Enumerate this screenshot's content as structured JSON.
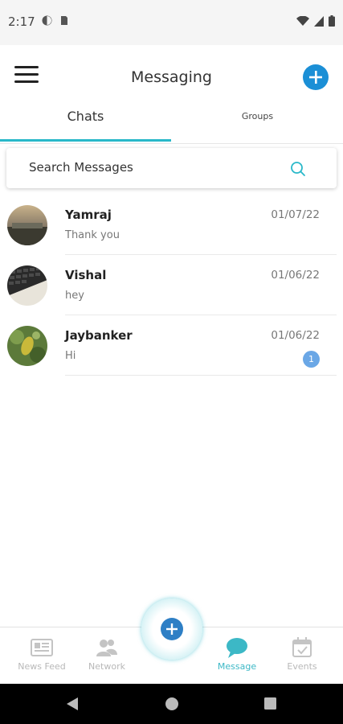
{
  "status_bar": {
    "time": "2:17"
  },
  "header": {
    "title": "Messaging"
  },
  "tabs": [
    {
      "label": "Chats",
      "active": true
    },
    {
      "label": "Groups",
      "active": false
    }
  ],
  "search": {
    "placeholder": "Search Messages"
  },
  "chats": [
    {
      "name": "Yamraj",
      "preview": "Thank you",
      "date": "01/07/22",
      "unread": ""
    },
    {
      "name": "Vishal",
      "preview": "hey",
      "date": "01/06/22",
      "unread": ""
    },
    {
      "name": "Jaybanker",
      "preview": "Hi",
      "date": "01/06/22",
      "unread": "1"
    }
  ],
  "bottom_nav": [
    {
      "label": "News Feed",
      "icon": "newsfeed-icon",
      "active": false
    },
    {
      "label": "Network",
      "icon": "network-icon",
      "active": false
    },
    {
      "label": "Message",
      "icon": "message-icon",
      "active": true
    },
    {
      "label": "Events",
      "icon": "events-icon",
      "active": false
    }
  ],
  "colors": {
    "accent": "#29b8c9",
    "primary_blue": "#1b8fd6",
    "badge": "#6aa7e6"
  }
}
